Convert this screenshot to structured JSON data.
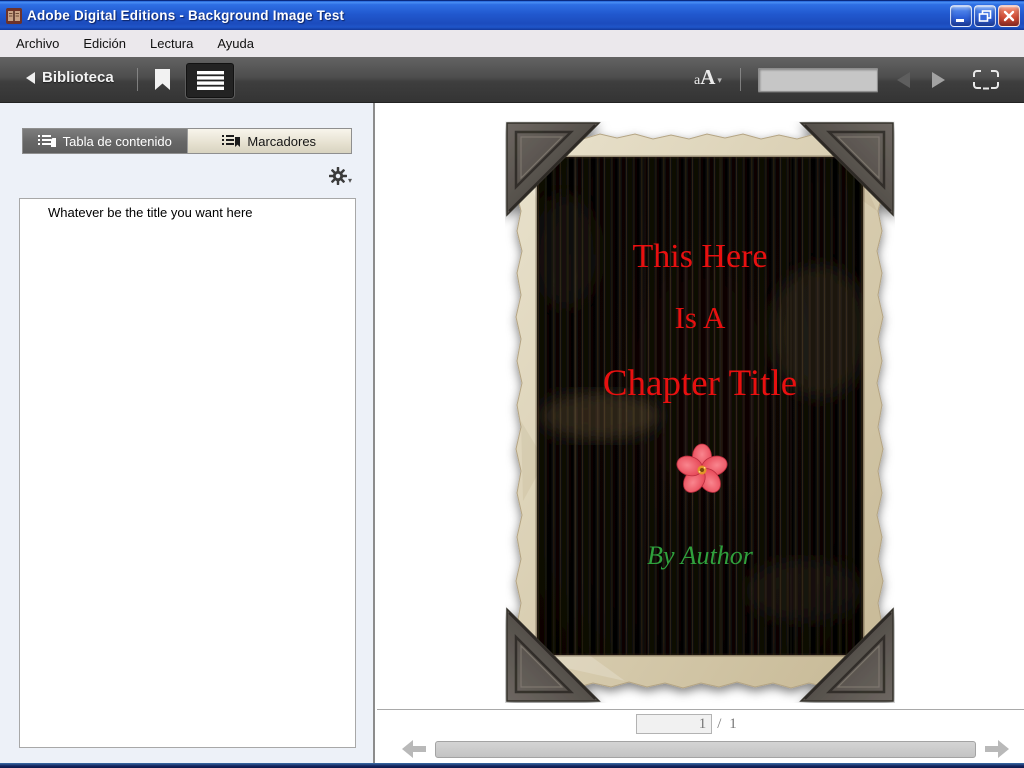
{
  "window": {
    "title": "Adobe Digital Editions - Background Image Test",
    "controls": {
      "minimize": "minimize",
      "restore": "restore-down",
      "close": "close"
    }
  },
  "menu": {
    "items": [
      {
        "label": "Archivo"
      },
      {
        "label": "Edición"
      },
      {
        "label": "Lectura"
      },
      {
        "label": "Ayuda"
      }
    ]
  },
  "toolbar": {
    "library_label": "Biblioteca",
    "font_size_small": "a",
    "font_size_big": "A",
    "dropdown_caret": "▾",
    "search_value": "",
    "icons": {
      "back": "left-triangle-icon",
      "bookmark": "bookmark-ribbon-icon",
      "toc_view": "list-lines-icon",
      "prev_page": "left-triangle-icon",
      "next_page": "right-triangle-icon",
      "fullscreen": "screen-frame-icon"
    }
  },
  "sidebar": {
    "tabs": [
      {
        "label": "Tabla de contenido",
        "active": true,
        "icon": "toc-list-icon"
      },
      {
        "label": "Marcadores",
        "active": false,
        "icon": "bookmark-list-icon"
      }
    ],
    "gear_caret": "▾",
    "toc_items": [
      {
        "label": "Whatever be the title you want here"
      }
    ]
  },
  "book": {
    "title_line1": "This Here",
    "title_line2": "Is A",
    "title_line3": "Chapter Title",
    "author": "By Author",
    "ornament": "red-flower",
    "title_color": "#e81010",
    "author_color": "#2fa03c",
    "paper_color": "#d8cdb0",
    "photo_color": "#120e09"
  },
  "pagination": {
    "current_page": "1",
    "separator": "/",
    "total_pages": "1"
  },
  "colors": {
    "titlebar_blue": "#2158ce",
    "toolbar_dark": "#474747",
    "sidebar_bg": "#edf1f8",
    "close_red": "#d04a33"
  }
}
